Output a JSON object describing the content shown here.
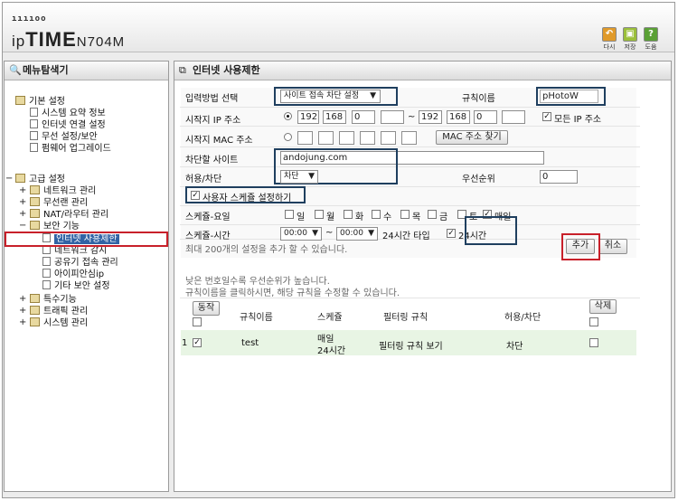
{
  "header": {
    "logo_dots": "ııııoo",
    "logo_ip": "ip",
    "logo_time": "TIME",
    "logo_model": "N704M",
    "toolbar": [
      {
        "label": "다시",
        "icon": "undo-icon",
        "color": "#e09a2a"
      },
      {
        "label": "저장",
        "icon": "save-icon",
        "color": "#9bbf3a"
      },
      {
        "label": "도움",
        "icon": "help-icon",
        "color": "#5aa035"
      }
    ]
  },
  "sidebar": {
    "title": "메뉴탐색기",
    "basic": {
      "label": "기본 설정",
      "items": [
        "시스템 요약 정보",
        "인터넷 연결 설정",
        "무선 설정/보안",
        "펌웨어 업그레이드"
      ]
    },
    "advanced": {
      "label": "고급 설정",
      "items": [
        "네트워크 관리",
        "무선랜 관리",
        "NAT/라우터 관리",
        "보안 기능"
      ],
      "security_items": [
        "인터넷 사용제한",
        "네트워크 감시",
        "공유기 접속 관리",
        "아이피안심ip",
        "기타 보안 설정"
      ],
      "after": [
        "특수기능",
        "트래픽 관리",
        "시스템 관리"
      ]
    }
  },
  "main": {
    "title": "인터넷 사용제한",
    "input_method_label": "입력방법 선택",
    "input_method_value": "사이트 접속 차단 설정",
    "rule_name_label": "규칙이름",
    "rule_name_value": "pHotoW",
    "start_ip_label": "시작지 IP 주소",
    "ip_from": [
      "192",
      "168",
      "0",
      ""
    ],
    "ip_sep": "~",
    "ip_to": [
      "192",
      "168",
      "0",
      ""
    ],
    "all_ip_label": "모든 IP 주소",
    "start_mac_label": "시작지 MAC 주소",
    "mac_search_button": "MAC 주소 찾기",
    "block_site_label": "차단할 사이트",
    "block_site_value": "andojung.com",
    "allow_block_label": "허용/차단",
    "allow_block_value": "차단",
    "priority_label": "우선순위",
    "priority_value": "0",
    "use_schedule_label": "사용자 스케쥴 설정하기",
    "schedule_day_label": "스케쥴-요일",
    "days": [
      "일",
      "월",
      "화",
      "수",
      "목",
      "금",
      "토"
    ],
    "everyday_label": "매일",
    "schedule_time_label": "스케쥴-시간",
    "time_from": "00:00",
    "time_to": "00:00",
    "time_type": "24시간 타입",
    "hours24_label": "24시간",
    "max_note": "최대 200개의 설정을 추가 할 수 있습니다.",
    "add_button": "추가",
    "cancel_button": "취소",
    "note1": "낮은 번호일수록 우선순위가 높습니다.",
    "note2": "규칙이름을 클릭하시면, 해당 규칙을 수정할 수 있습니다.",
    "table": {
      "operate_button": "동작",
      "delete_button": "삭제",
      "columns": [
        "규칙이름",
        "스케쥴",
        "필터링 규칙",
        "허용/차단"
      ],
      "rows": [
        {
          "no": "1",
          "name": "test",
          "schedule_line1": "매일",
          "schedule_line2": "24시간",
          "filter": "필터링 규칙 보기",
          "action": "차단"
        }
      ]
    }
  }
}
